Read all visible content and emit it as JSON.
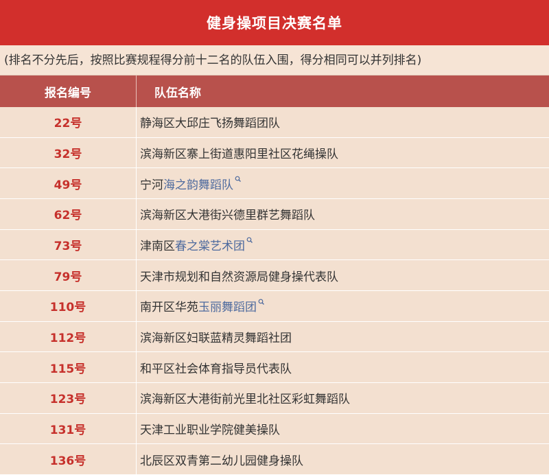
{
  "title": "健身操项目决赛名单",
  "note": "(排名不分先后，按照比赛规程得分前十二名的队伍入围，得分相同可以并列排名)",
  "columns": {
    "number": "报名编号",
    "team": "队伍名称"
  },
  "rows": [
    {
      "number": "22号",
      "prefix": "静海区大邱庄飞扬舞蹈团队",
      "link": ""
    },
    {
      "number": "32号",
      "prefix": "滨海新区寨上街道惠阳里社区花绳操队",
      "link": ""
    },
    {
      "number": "49号",
      "prefix": "宁河",
      "link": "海之韵舞蹈队"
    },
    {
      "number": "62号",
      "prefix": "滨海新区大港街兴德里群艺舞蹈队",
      "link": ""
    },
    {
      "number": "73号",
      "prefix": "津南区",
      "link": "春之棠艺术团"
    },
    {
      "number": "79号",
      "prefix": "天津市规划和自然资源局健身操代表队",
      "link": ""
    },
    {
      "number": "110号",
      "prefix": "南开区华苑",
      "link": "玉丽舞蹈团"
    },
    {
      "number": "112号",
      "prefix": "滨海新区妇联蓝精灵舞蹈社团",
      "link": ""
    },
    {
      "number": "115号",
      "prefix": "和平区社会体育指导员代表队",
      "link": ""
    },
    {
      "number": "123号",
      "prefix": "滨海新区大港街前光里北社区彩虹舞蹈队",
      "link": ""
    },
    {
      "number": "131号",
      "prefix": "天津工业职业学院健美操队",
      "link": ""
    },
    {
      "number": "136号",
      "prefix": "北辰区双青第二幼儿园健身操队",
      "link": ""
    }
  ]
}
